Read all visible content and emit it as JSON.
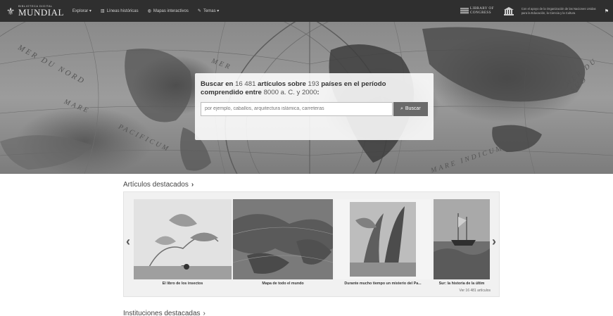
{
  "header": {
    "logo_small": "BIBLIOTECA DIGITAL",
    "logo_big": "MUNDIAL",
    "nav": [
      {
        "label": "Explorar ▾",
        "icon": ""
      },
      {
        "label": "Líneas históricas",
        "icon": "timeline-icon"
      },
      {
        "label": "Mapas interactivos",
        "icon": "globe-icon"
      },
      {
        "label": "Temas ▾",
        "icon": "tag-icon"
      }
    ],
    "loc_line1": "LIBRARY OF",
    "loc_line2": "CONGRESS",
    "support_text": "Con el apoyo de la Organización de las Naciones Unidas para la Educación, la Ciencia y la Cultura"
  },
  "hero": {
    "labels": [
      "MER DU NORD",
      "MARE",
      "PACIFICUM",
      "MER",
      "MER DU SUD",
      "MARE INDICUM"
    ],
    "search": {
      "heading_pre": "Buscar en ",
      "count_items": "16 481",
      "heading_mid1": " artículos sobre ",
      "count_countries": "193",
      "heading_mid2": " países en el período comprendido entre ",
      "period": "8000 a. C. y 2000",
      "heading_post": ":",
      "placeholder": "por ejemplo, caballos, arquitectura islámica, carreteras",
      "button": "Buscar"
    }
  },
  "featured": {
    "title": "Artículos destacados",
    "items": [
      {
        "caption": "El libro de los insectos"
      },
      {
        "caption": "Mapa de todo el mundo"
      },
      {
        "caption": "Durante mucho tiempo un misterio del Pa..."
      },
      {
        "caption": "Sur: la historia de la últim"
      }
    ],
    "see_all": "Ver 16 481 artículos"
  },
  "institutions": {
    "title": "Instituciones destacadas"
  }
}
